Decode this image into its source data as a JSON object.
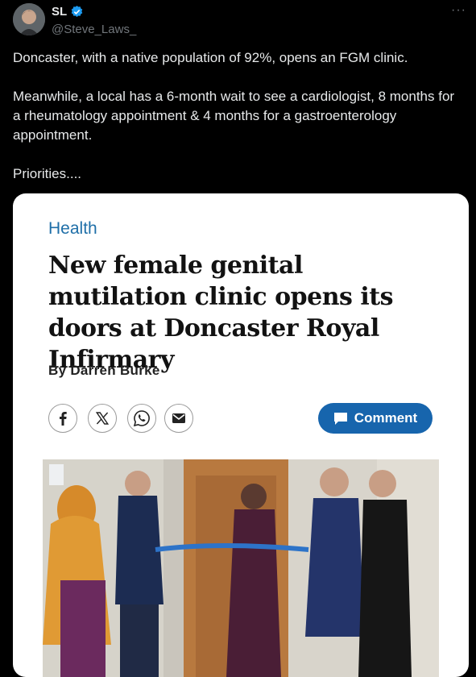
{
  "tweet": {
    "author_name": "SL",
    "author_handle": "@Steve_Laws_",
    "more_label": "···",
    "text_lines": [
      "Doncaster, with a native population of 92%, opens an FGM clinic.",
      "Meanwhile, a local has a 6-month wait to see a cardiologist, 8 months for a rheumatology appointment & 4 months for a gastroenterology appointment.",
      "Priorities...."
    ]
  },
  "article": {
    "section": "Health",
    "headline": "New female genital mutilation clinic opens its doors at Doncaster Royal Infirmary",
    "byline": "By Darren Burke",
    "share_icons": [
      "facebook-icon",
      "x-icon",
      "whatsapp-icon",
      "email-icon"
    ],
    "comment_label": "Comment"
  },
  "colors": {
    "background": "#000000",
    "section": "#1f6fa8",
    "comment_button": "#1765ad",
    "verified": "#1d9bf0"
  }
}
